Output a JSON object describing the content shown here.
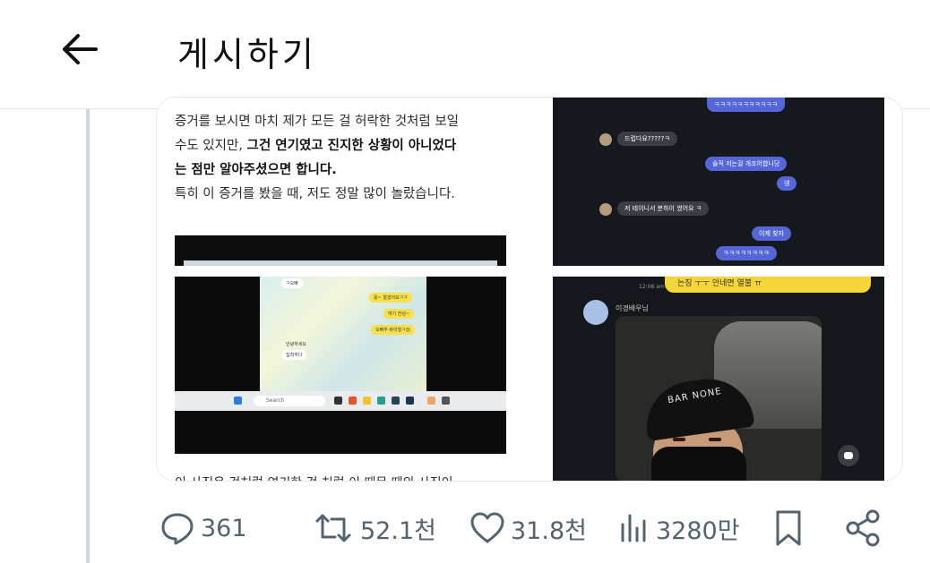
{
  "header": {
    "title": "게시하기"
  },
  "article": {
    "line1": "증거를 보시면 마치 제가 모든 걸 허락한 것처럼 보일",
    "line2a": "수도 있지만, ",
    "line2b": "그건 연기였고 진지한 상황이 아니었다",
    "line3": "는 점만 알아주셨으면 합니다.",
    "line4": "특히 이 증거를 봤을 때, 저도 정말 많이 놀랐습니다.",
    "cut_line": "이 사진은 것처럼 연기한 것 처럼 이 때문 때의 사진이"
  },
  "chat_top": {
    "msg1": "ㅋㅋㅋㅋㅋㅋㅋㅋㅋㅋㅋ",
    "msg2": "드럽다요?????ㅋ",
    "msg3": "솔직 저는걸 개조어합니당",
    "msg4": "넹",
    "msg5": "저 테이니서 분하이 썼어요 ㅋ",
    "msg6": "이제 찾자",
    "msg7": "ㅋㅋㅋㅋㅋㅋㅋㅋ"
  },
  "laptop": {
    "b1": "응~ 알겠어요ㅋㅋ",
    "b2": "여기 찬성~",
    "b3": "오빠추 바이럴ㅋ😊",
    "w1": "ㅋ오빠",
    "w2": "집착하다",
    "w3": "안녕하세요",
    "search": "Search"
  },
  "selfie": {
    "yellow_msg": "는징 ㅜㅜ 안네면 열불 ㅠ",
    "time": "12:08 am",
    "sender": "이경배우님",
    "cap_text": "BAR NONE"
  },
  "actions": {
    "reply_count": "361",
    "retweet_count": "52.1천",
    "like_count": "31.8천",
    "view_count": "3280만"
  }
}
